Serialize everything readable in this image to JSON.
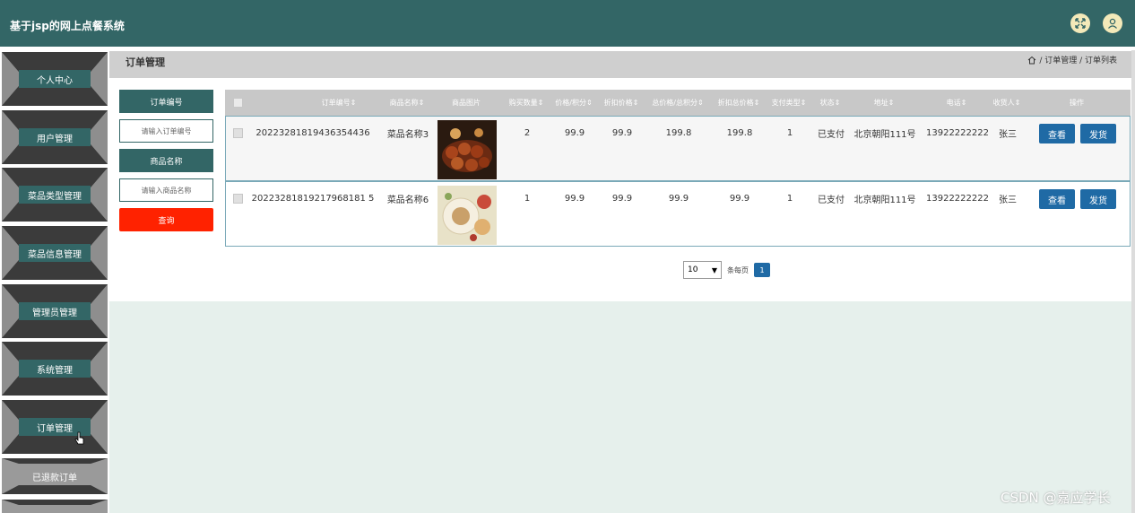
{
  "app": {
    "title": "基于jsp的网上点餐系统"
  },
  "sidebar": {
    "items": [
      {
        "label": "个人中心"
      },
      {
        "label": "用户管理"
      },
      {
        "label": "菜品类型管理"
      },
      {
        "label": "菜品信息管理"
      },
      {
        "label": "管理员管理"
      },
      {
        "label": "系统管理"
      },
      {
        "label": "订单管理"
      },
      {
        "label": "已退款订单"
      }
    ]
  },
  "breadcrumb": {
    "page_title": "订单管理",
    "path": "/ 订单管理 / 订单列表"
  },
  "filters": {
    "order_no_label": "订单编号",
    "order_no_placeholder": "请输入订单编号",
    "dish_name_label": "商品名称",
    "dish_name_placeholder": "请输入商品名称",
    "search_label": "查询"
  },
  "table": {
    "headers": [
      "订单编号",
      "商品名称",
      "商品图片",
      "购买数量",
      "价格/积分",
      "折扣价格",
      "总价格/总积分",
      "折扣总价格",
      "支付类型",
      "状态",
      "地址",
      "电话",
      "收货人",
      "操作"
    ],
    "rows": [
      {
        "order_no": "20223281819436354436",
        "dish": "菜品名称3",
        "qty": "2",
        "price": "99.9",
        "discount_price": "99.9",
        "total": "199.8",
        "discount_total": "199.8",
        "pay_type": "1",
        "status": "已支付",
        "address": "北京朝阳111号",
        "phone": "13922222222",
        "receiver": "张三"
      },
      {
        "order_no": "20223281819217968181 5",
        "dish": "菜品名称6",
        "qty": "1",
        "price": "99.9",
        "discount_price": "99.9",
        "total": "99.9",
        "discount_total": "99.9",
        "pay_type": "1",
        "status": "已支付",
        "address": "北京朝阳111号",
        "phone": "13922222222",
        "receiver": "张三"
      }
    ],
    "view_label": "查看",
    "ship_label": "发货"
  },
  "pagination": {
    "page_size": "10",
    "per_page_text": "条每页",
    "current_page": "1"
  },
  "watermark": "CSDN @嘉应学长",
  "colors": {
    "header": "#336666",
    "primary_button": "#1f6aa5",
    "search_button": "#ff2200",
    "lower_background": "#e6f0ec"
  }
}
